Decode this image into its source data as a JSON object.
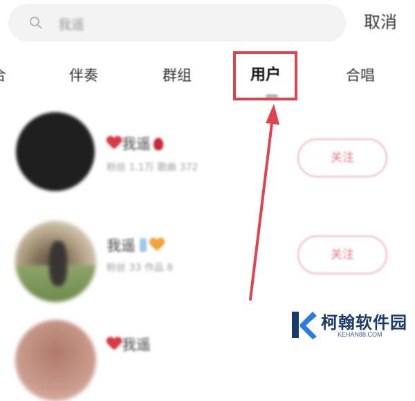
{
  "search": {
    "value": "我遥",
    "cancel_label": "取消"
  },
  "tabs": [
    {
      "label": "合"
    },
    {
      "label": "伴奏"
    },
    {
      "label": "群组"
    },
    {
      "label": "用户",
      "active": true
    },
    {
      "label": "合唱"
    }
  ],
  "results": [
    {
      "name": "我遥",
      "meta": "粉丝 1.1万 歌曲 372",
      "badges": [
        "heart-icon",
        "rose-icon"
      ],
      "follow_label": "关注"
    },
    {
      "name": "我遥",
      "meta": "粉丝 33 作品 8",
      "badges": [
        "bottle-icon",
        "heart-icon"
      ],
      "follow_label": "关注"
    },
    {
      "name": "我遥",
      "badges": [
        "heart-icon"
      ]
    }
  ],
  "annotation": {
    "color": "#e04250"
  },
  "watermark": {
    "title": "柯翰软件园",
    "subtitle": "KEHAN88.COM",
    "color": "#1a3a6b"
  }
}
